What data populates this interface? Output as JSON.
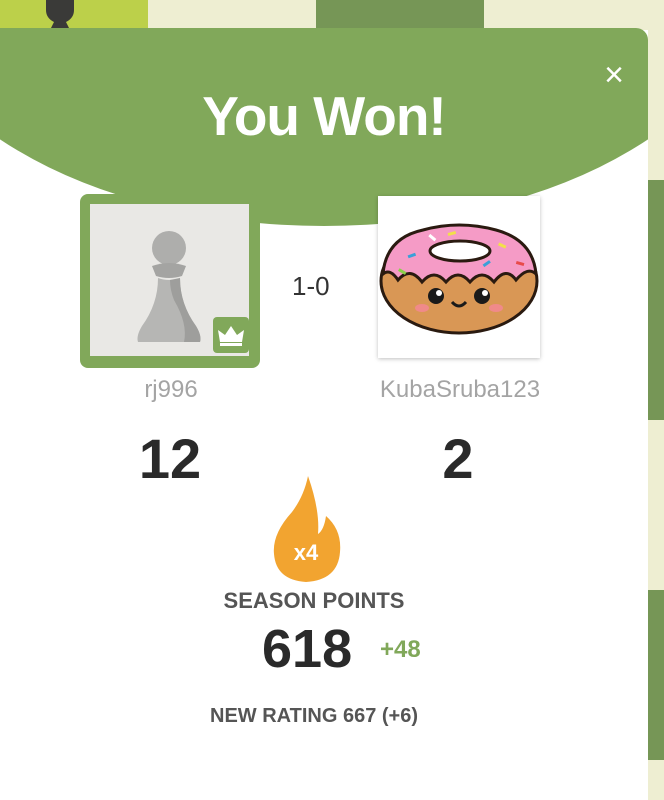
{
  "dialog": {
    "title": "You Won!",
    "close_label": "×",
    "score": "1-0"
  },
  "players": {
    "left": {
      "username": "rj996",
      "rating": "12",
      "avatar": "pawn-icon",
      "badge": "crown-icon"
    },
    "right": {
      "username": "KubaSruba123",
      "rating": "2",
      "avatar": "donut-image"
    }
  },
  "season": {
    "multiplier": "x4",
    "label": "SEASON POINTS",
    "points": "618",
    "delta": "+48"
  },
  "new_rating": "NEW RATING 667 (+6)",
  "colors": {
    "accent": "#81a85a",
    "board_light": "#eeeed2",
    "board_dark": "#769656",
    "flame": "#f2a430",
    "delta": "#81a85a"
  }
}
